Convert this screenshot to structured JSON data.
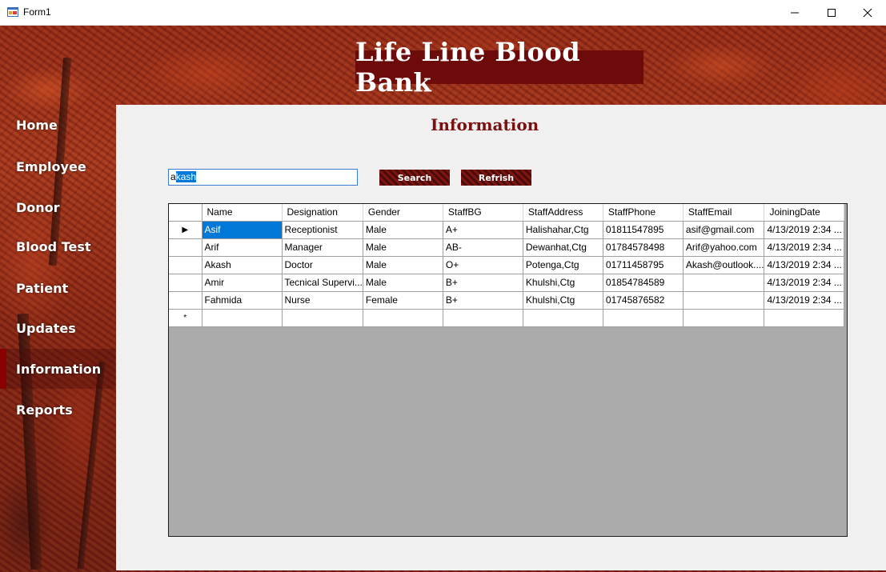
{
  "window": {
    "title": "Form1",
    "minimize_glyph": "—",
    "maximize_glyph": "☐",
    "close_glyph": "✕"
  },
  "banner": {
    "title": "Life Line Blood Bank"
  },
  "nav": {
    "items": [
      {
        "label": "Home"
      },
      {
        "label": "Employee"
      },
      {
        "label": "Donor"
      },
      {
        "label": "Blood Test"
      },
      {
        "label": "Patient"
      },
      {
        "label": "Updates"
      },
      {
        "label": "Information"
      },
      {
        "label": "Reports"
      }
    ],
    "active": "Information"
  },
  "main": {
    "title": "Information",
    "search": {
      "value_prefix": "a",
      "value_selected": "kash"
    },
    "search_button": "Search",
    "refresh_button": "Refrish"
  },
  "grid": {
    "columns": [
      "Name",
      "Designation",
      "Gender",
      "StaffBG",
      "StaffAddress",
      "StaffPhone",
      "StaffEmail",
      "JoiningDate"
    ],
    "rows": [
      [
        "Asif",
        "Receptionist",
        "Male",
        "A+",
        "Halishahar,Ctg",
        "01811547895",
        "asif@gmail.com",
        "4/13/2019 2:34 ..."
      ],
      [
        "Arif",
        "Manager",
        "Male",
        "AB-",
        "Dewanhat,Ctg",
        "01784578498",
        "Arif@yahoo.com",
        "4/13/2019 2:34 ..."
      ],
      [
        "Akash",
        "Doctor",
        "Male",
        "O+",
        "Potenga,Ctg",
        "01711458795",
        "Akash@outlook....",
        "4/13/2019 2:34 ..."
      ],
      [
        "Amir",
        "Tecnical Supervi...",
        "Male",
        "B+",
        "Khulshi,Ctg",
        "01854784589",
        "",
        "4/13/2019 2:34 ..."
      ],
      [
        "Fahmida",
        "Nurse",
        "Female",
        "B+",
        "Khulshi,Ctg",
        "01745876582",
        "",
        "4/13/2019 2:34 ..."
      ]
    ],
    "current_row_glyph": "▶",
    "new_row_glyph": "*"
  },
  "colors": {
    "banner_bg": "#6d0a0a",
    "title_color": "#7a1010",
    "selection": "#0078d7",
    "grid_bg": "#ababab",
    "panel_bg": "#f0f0f0"
  }
}
